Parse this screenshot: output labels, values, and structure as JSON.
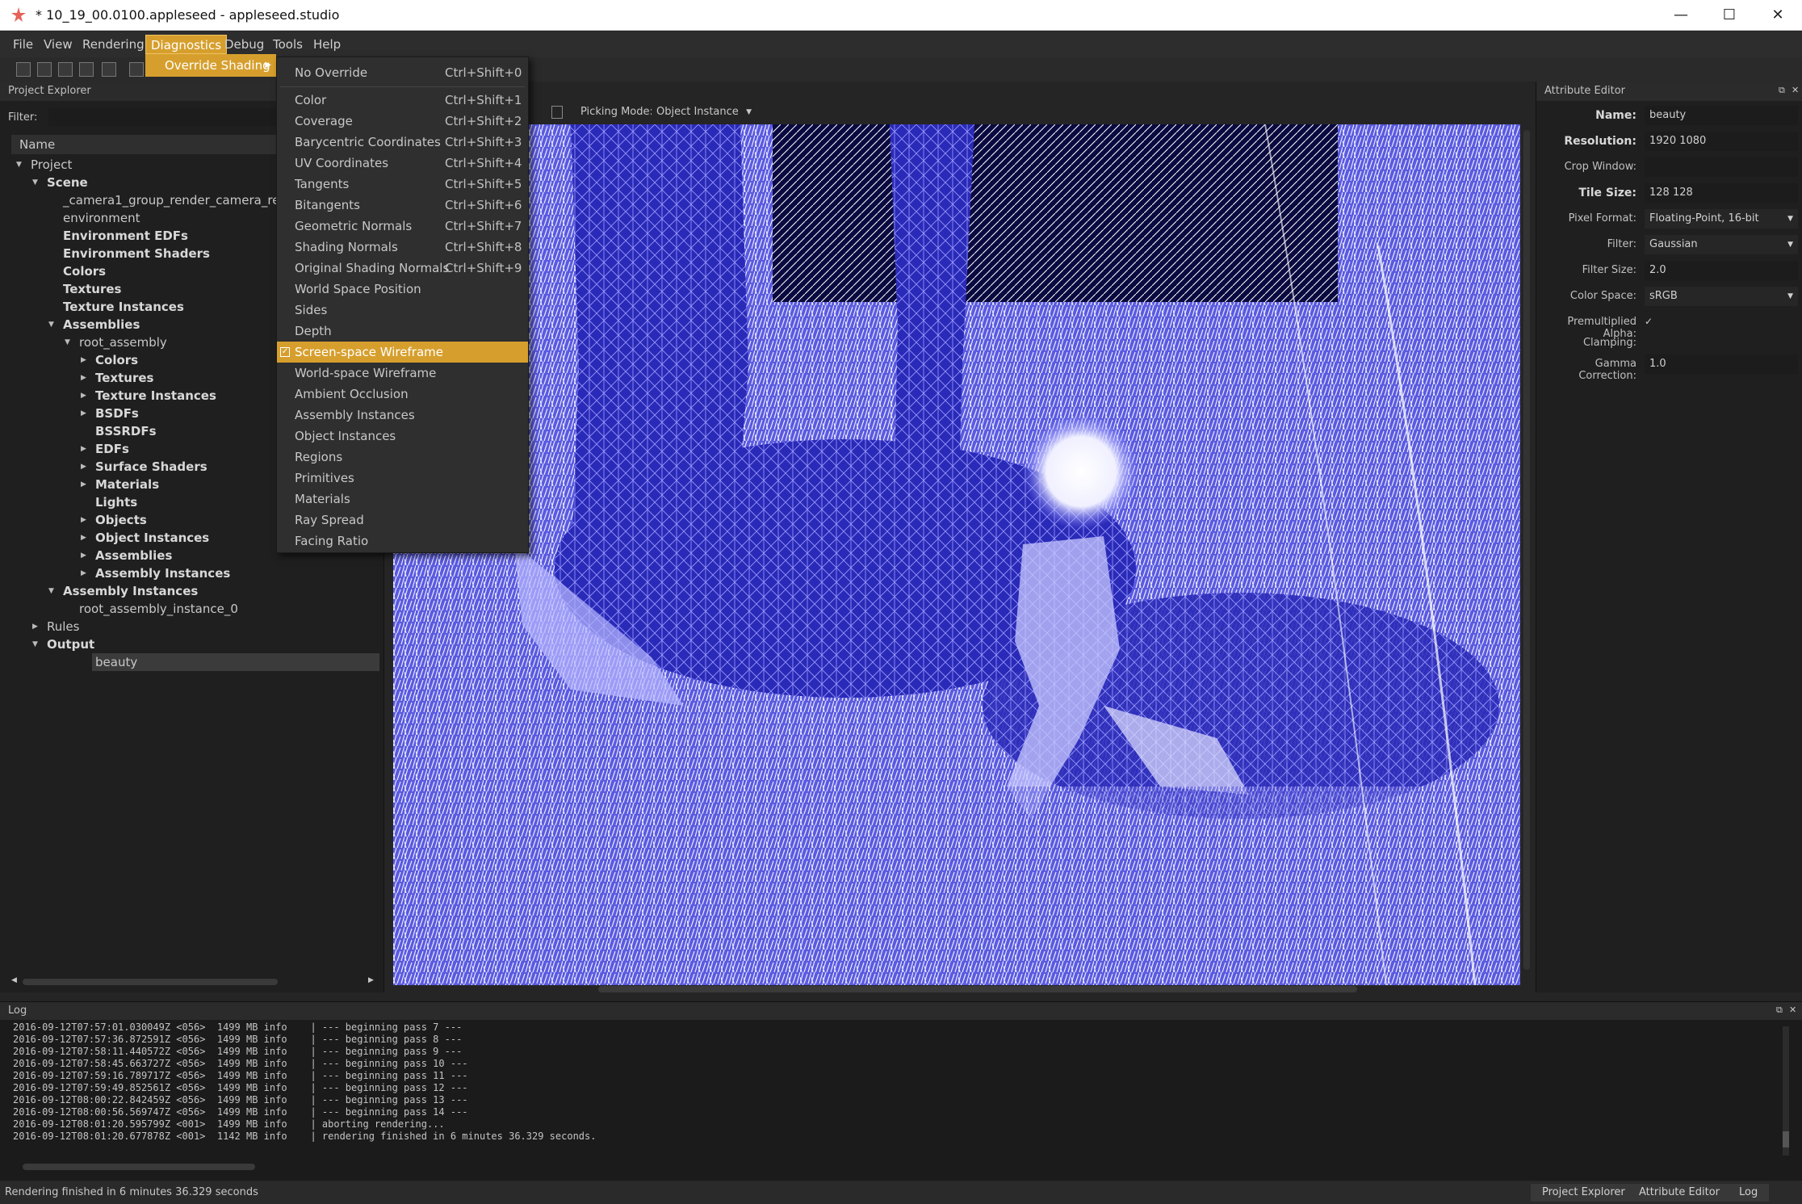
{
  "window": {
    "title": "* 10_19_00.0100.appleseed - appleseed.studio",
    "minimize": "—",
    "maximize": "☐",
    "close": "✕"
  },
  "menubar": {
    "items": [
      "File",
      "View",
      "Rendering",
      "Diagnostics",
      "Debug",
      "Tools",
      "Help"
    ],
    "active": "Diagnostics"
  },
  "diagnostics_menu": {
    "override_shading": "Override Shading",
    "items": [
      {
        "label": "No Override",
        "shortcut": "Ctrl+Shift+0"
      },
      {
        "label": "Color",
        "shortcut": "Ctrl+Shift+1"
      },
      {
        "label": "Coverage",
        "shortcut": "Ctrl+Shift+2"
      },
      {
        "label": "Barycentric Coordinates",
        "shortcut": "Ctrl+Shift+3"
      },
      {
        "label": "UV Coordinates",
        "shortcut": "Ctrl+Shift+4"
      },
      {
        "label": "Tangents",
        "shortcut": "Ctrl+Shift+5"
      },
      {
        "label": "Bitangents",
        "shortcut": "Ctrl+Shift+6"
      },
      {
        "label": "Geometric Normals",
        "shortcut": "Ctrl+Shift+7"
      },
      {
        "label": "Shading Normals",
        "shortcut": "Ctrl+Shift+8"
      },
      {
        "label": "Original Shading Normals",
        "shortcut": "Ctrl+Shift+9"
      },
      {
        "label": "World Space Position",
        "shortcut": ""
      },
      {
        "label": "Sides",
        "shortcut": ""
      },
      {
        "label": "Depth",
        "shortcut": ""
      },
      {
        "label": "Screen-space Wireframe",
        "shortcut": "",
        "checked": true
      },
      {
        "label": "World-space Wireframe",
        "shortcut": ""
      },
      {
        "label": "Ambient Occlusion",
        "shortcut": ""
      },
      {
        "label": "Assembly Instances",
        "shortcut": ""
      },
      {
        "label": "Object Instances",
        "shortcut": ""
      },
      {
        "label": "Regions",
        "shortcut": ""
      },
      {
        "label": "Primitives",
        "shortcut": ""
      },
      {
        "label": "Materials",
        "shortcut": ""
      },
      {
        "label": "Ray Spread",
        "shortcut": ""
      },
      {
        "label": "Facing Ratio",
        "shortcut": ""
      }
    ]
  },
  "project_explorer": {
    "title": "Project Explorer",
    "filter_label": "Filter:",
    "column_header": "Name",
    "tree": [
      {
        "label": "Project",
        "depth": 0,
        "bold": false,
        "arrow": "down"
      },
      {
        "label": "Scene",
        "depth": 1,
        "bold": true,
        "arrow": "down"
      },
      {
        "label": "_camera1_group_render_camera_render",
        "depth": 2,
        "bold": false,
        "arrow": ""
      },
      {
        "label": "environment",
        "depth": 2,
        "bold": false,
        "arrow": ""
      },
      {
        "label": "Environment EDFs",
        "depth": 2,
        "bold": true,
        "arrow": ""
      },
      {
        "label": "Environment Shaders",
        "depth": 2,
        "bold": true,
        "arrow": ""
      },
      {
        "label": "Colors",
        "depth": 2,
        "bold": true,
        "arrow": ""
      },
      {
        "label": "Textures",
        "depth": 2,
        "bold": true,
        "arrow": ""
      },
      {
        "label": "Texture Instances",
        "depth": 2,
        "bold": true,
        "arrow": ""
      },
      {
        "label": "Assemblies",
        "depth": 2,
        "bold": true,
        "arrow": "down"
      },
      {
        "label": "root_assembly",
        "depth": 3,
        "bold": false,
        "arrow": "down"
      },
      {
        "label": "Colors",
        "depth": 4,
        "bold": true,
        "arrow": "right"
      },
      {
        "label": "Textures",
        "depth": 4,
        "bold": true,
        "arrow": "right"
      },
      {
        "label": "Texture Instances",
        "depth": 4,
        "bold": true,
        "arrow": "right"
      },
      {
        "label": "BSDFs",
        "depth": 4,
        "bold": true,
        "arrow": "right"
      },
      {
        "label": "BSSRDFs",
        "depth": 4,
        "bold": true,
        "arrow": ""
      },
      {
        "label": "EDFs",
        "depth": 4,
        "bold": true,
        "arrow": "right"
      },
      {
        "label": "Surface Shaders",
        "depth": 4,
        "bold": true,
        "arrow": "right"
      },
      {
        "label": "Materials",
        "depth": 4,
        "bold": true,
        "arrow": "right"
      },
      {
        "label": "Lights",
        "depth": 4,
        "bold": true,
        "arrow": ""
      },
      {
        "label": "Objects",
        "depth": 4,
        "bold": true,
        "arrow": "right"
      },
      {
        "label": "Object Instances",
        "depth": 4,
        "bold": true,
        "arrow": "right"
      },
      {
        "label": "Assemblies",
        "depth": 4,
        "bold": true,
        "arrow": "right"
      },
      {
        "label": "Assembly Instances",
        "depth": 4,
        "bold": true,
        "arrow": "right"
      },
      {
        "label": "Assembly Instances",
        "depth": 2,
        "bold": true,
        "arrow": "down"
      },
      {
        "label": "root_assembly_instance_0",
        "depth": 3,
        "bold": false,
        "arrow": ""
      },
      {
        "label": "Rules",
        "depth": 1,
        "bold": false,
        "arrow": "right"
      },
      {
        "label": "Output",
        "depth": 1,
        "bold": true,
        "arrow": "down"
      },
      {
        "label": "beauty",
        "depth": 2,
        "bold": false,
        "arrow": "",
        "selected": true
      }
    ]
  },
  "viewport": {
    "picking_mode_label": "Picking Mode:",
    "picking_mode_value": "Object Instance"
  },
  "attribute_editor": {
    "title": "Attribute Editor",
    "fields": [
      {
        "label": "Name:",
        "value": "beauty",
        "bold": true,
        "kind": "text"
      },
      {
        "label": "Resolution:",
        "value": "1920 1080",
        "bold": true,
        "kind": "text"
      },
      {
        "label": "Crop Window:",
        "value": "",
        "bold": false,
        "kind": "text"
      },
      {
        "label": "Tile Size:",
        "value": "128 128",
        "bold": true,
        "kind": "text"
      },
      {
        "label": "Pixel Format:",
        "value": "Floating-Point, 16-bit",
        "bold": false,
        "kind": "combo"
      },
      {
        "label": "Filter:",
        "value": "Gaussian",
        "bold": false,
        "kind": "combo"
      },
      {
        "label": "Filter Size:",
        "value": "2.0",
        "bold": false,
        "kind": "text"
      },
      {
        "label": "Color Space:",
        "value": "sRGB",
        "bold": false,
        "kind": "combo"
      },
      {
        "label": "Premultiplied Alpha:",
        "value": "✓",
        "bold": false,
        "kind": "check"
      },
      {
        "label": "Clamping:",
        "value": "",
        "bold": false,
        "kind": "check"
      },
      {
        "label": "Gamma Correction:",
        "value": "1.0",
        "bold": false,
        "kind": "text"
      }
    ]
  },
  "log": {
    "title": "Log",
    "lines": [
      "2016-09-12T07:57:01.030049Z <056>  1499 MB info    | --- beginning pass 7 ---",
      "2016-09-12T07:57:36.872591Z <056>  1499 MB info    | --- beginning pass 8 ---",
      "2016-09-12T07:58:11.440572Z <056>  1499 MB info    | --- beginning pass 9 ---",
      "2016-09-12T07:58:45.663727Z <056>  1499 MB info    | --- beginning pass 10 ---",
      "2016-09-12T07:59:16.789717Z <056>  1499 MB info    | --- beginning pass 11 ---",
      "2016-09-12T07:59:49.852561Z <056>  1499 MB info    | --- beginning pass 12 ---",
      "2016-09-12T08:00:22.842459Z <056>  1499 MB info    | --- beginning pass 13 ---",
      "2016-09-12T08:00:56.569747Z <056>  1499 MB info    | --- beginning pass 14 ---",
      "2016-09-12T08:01:20.595799Z <001>  1499 MB info    | aborting rendering...",
      "2016-09-12T08:01:20.677878Z <001>  1142 MB info    | rendering finished in 6 minutes 36.329 seconds."
    ]
  },
  "statusbar": {
    "text": "Rendering finished in 6 minutes 36.329 seconds",
    "tabs": [
      "Project Explorer",
      "Attribute Editor",
      "Log"
    ]
  },
  "colors": {
    "accent": "#d69f2d",
    "render_tint": "#1a1a9a"
  }
}
